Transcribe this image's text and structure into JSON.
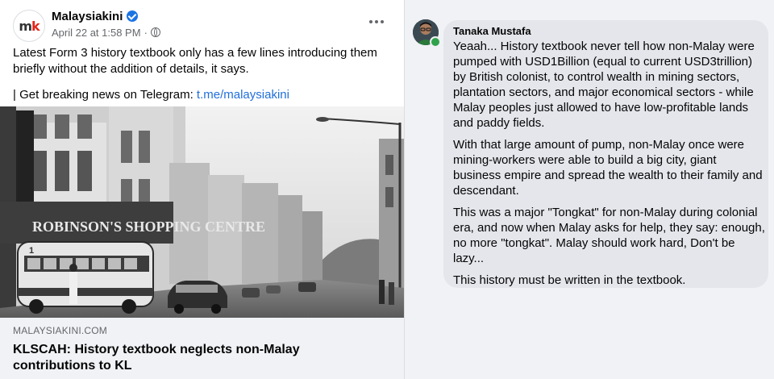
{
  "post": {
    "page_name": "Malaysiakini",
    "date": "April 22 at 1:58 PM",
    "meta_separator": "·",
    "avatar_letters": {
      "m": "m",
      "k": "k"
    },
    "text_line_1": "Latest Form 3 history textbook only has a few lines introducing them briefly without the addition of details, it says.",
    "text_line_2_prefix": "| Get breaking news on Telegram: ",
    "telegram_link": "t.me/malaysiakini",
    "link_preview": {
      "domain": "MALAYSIAKINI.COM",
      "title": "KLSCAH: History textbook neglects non-Malay contributions to KL"
    },
    "image": {
      "storefront_sign": "ROBINSON'S SHOPPING CENTRE",
      "bus_number": "1"
    },
    "colors": {
      "verified": "#1b74e4",
      "link": "#216fdb",
      "brand_red": "#e1251b"
    }
  },
  "comment": {
    "author": "Tanaka Mustafa",
    "paragraphs": [
      "Yeaah... History textbook never tell how non-Malay were pumped with USD1Billion (equal to current USD3trillion) by British colonist, to control wealth in mining sectors, plantation sectors, and major economical sectors - while Malay peoples just allowed to have low-profitable lands and paddy fields.",
      "With that large amount of pump, non-Malay once were mining-workers were able to build a big city, giant business empire and spread the wealth to their family and descendant.",
      "This was a major \"Tongkat\" for non-Malay during colonial era, and now when Malay asks for help, they say: enough, no more \"tongkat\". Malay should work hard, Don't be lazy...",
      "This history must be written in the textbook."
    ],
    "colors": {
      "online": "#31a24c",
      "bubble": "#e4e6eb"
    }
  }
}
